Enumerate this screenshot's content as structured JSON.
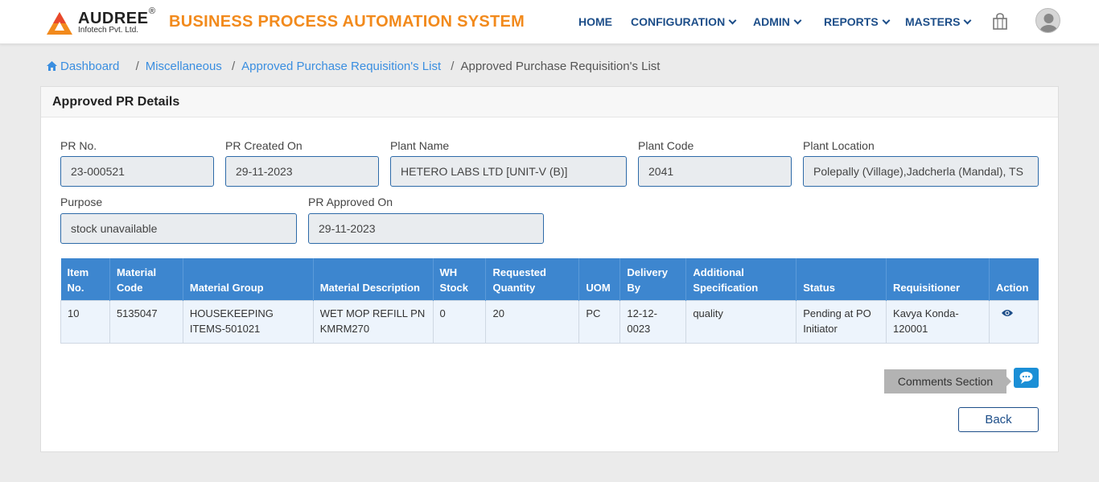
{
  "header": {
    "logo_name": "AUDREE",
    "logo_reg": "®",
    "logo_sub": "Infotech Pvt. Ltd.",
    "app_title": "BUSINESS PROCESS AUTOMATION SYSTEM",
    "nav": {
      "home": "HOME",
      "configuration": "CONFIGURATION",
      "admin": "ADMIN",
      "reports": "REPORTS",
      "masters": "MASTERS"
    },
    "accent_color": "#f28a1c",
    "nav_color": "#1d4e89"
  },
  "breadcrumb": {
    "dashboard": "Dashboard",
    "misc": "Miscellaneous",
    "list": "Approved Purchase Requisition's List",
    "current": "Approved Purchase Requisition's List",
    "sep": "/"
  },
  "card": {
    "title": "Approved PR Details"
  },
  "fields": {
    "pr_no": {
      "label": "PR No.",
      "value": "23-000521"
    },
    "pr_created": {
      "label": "PR Created On",
      "value": "29-11-2023"
    },
    "plant_name": {
      "label": "Plant Name",
      "value": "HETERO LABS LTD [UNIT-V (B)]"
    },
    "plant_code": {
      "label": "Plant Code",
      "value": "2041"
    },
    "plant_location": {
      "label": "Plant Location",
      "value": "Polepally (Village),Jadcherla (Mandal), TS"
    },
    "purpose": {
      "label": "Purpose",
      "value": "stock unavailable"
    },
    "pr_approved": {
      "label": "PR Approved On",
      "value": "29-11-2023"
    }
  },
  "table": {
    "headers": [
      "Item No.",
      "Material Code",
      "Material Group",
      "Material Description",
      "WH Stock",
      "Requested Quantity",
      "UOM",
      "Delivery By",
      "Additional Specification",
      "Status",
      "Requisitioner",
      "Action"
    ],
    "rows": [
      [
        "10",
        "5135047",
        "HOUSEKEEPING ITEMS-501021",
        "WET MOP REFILL PN KMRM270",
        "0",
        "20",
        "PC",
        "12-12-0023",
        "quality",
        "Pending at PO Initiator",
        "Kavya Konda-120001"
      ]
    ]
  },
  "comments_label": "Comments Section",
  "back_label": "Back"
}
